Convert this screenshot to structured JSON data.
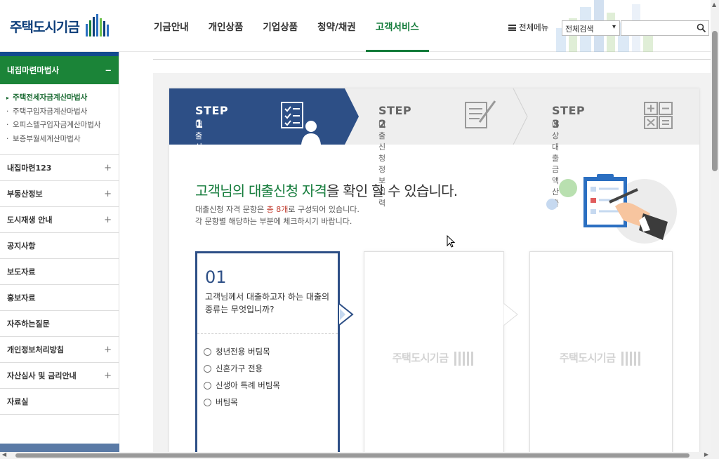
{
  "header": {
    "logo_text": "주택도시기금",
    "nav": [
      "기금안내",
      "개인상품",
      "기업상품",
      "청약/채권",
      "고객서비스"
    ],
    "active_nav": "고객서비스",
    "all_menu": "전체메뉴",
    "search_select": "전체검색",
    "search_placeholder": ""
  },
  "sidebar": {
    "head": "내집마련마법사",
    "head_toggle": "−",
    "sub_items": [
      {
        "label": "주택전세자금계산마법사",
        "active": true
      },
      {
        "label": "주택구입자금계산마법사",
        "active": false
      },
      {
        "label": "오피스텔구입자금계산마법사",
        "active": false
      },
      {
        "label": "보증부월세계산마법사",
        "active": false
      }
    ],
    "items": [
      {
        "label": "내집마련123",
        "plus": "+"
      },
      {
        "label": "부동산정보",
        "plus": "+"
      },
      {
        "label": "도시재생 안내",
        "plus": "+"
      },
      {
        "label": "공지사항",
        "plus": ""
      },
      {
        "label": "보도자료",
        "plus": ""
      },
      {
        "label": "홍보자료",
        "plus": ""
      },
      {
        "label": "자주하는질문",
        "plus": ""
      },
      {
        "label": "개인정보처리방침",
        "plus": "+"
      },
      {
        "label": "자산심사 및 금리안내",
        "plus": "+"
      },
      {
        "label": "자료실",
        "plus": ""
      }
    ]
  },
  "steps": [
    {
      "label": "STEP 1",
      "desc": "대출신청 자격확인",
      "active": true
    },
    {
      "label": "STEP 2",
      "desc": "대출신청 정보입력",
      "active": false
    },
    {
      "label": "STEP 3",
      "desc": "예상대출 금액산출",
      "active": false
    }
  ],
  "main": {
    "headline_highlight": "고객님의 대출신청 자격",
    "headline_rest": "을 확인 할 수 있습니다.",
    "desc_line1_pre": "대출신청 자격 문항은 ",
    "desc_line1_count": "총 8개",
    "desc_line1_post": "로 구성되어 있습니다.",
    "desc_line2": "각 문항별 해당하는 부분에 체크하시기 바랍니다."
  },
  "question": {
    "number": "01",
    "text": "고객님께서 대출하고자 하는 대출의 종류는 무엇입니까?",
    "options": [
      "청년전용 버팀목",
      "신혼가구 전용",
      "신생아 특례 버팀목",
      "버팀목"
    ]
  },
  "watermark": "주택도시기금",
  "colors": {
    "brand_green": "#137b3a",
    "brand_navy": "#2d4f86",
    "sidebar_head": "#1b8438"
  }
}
